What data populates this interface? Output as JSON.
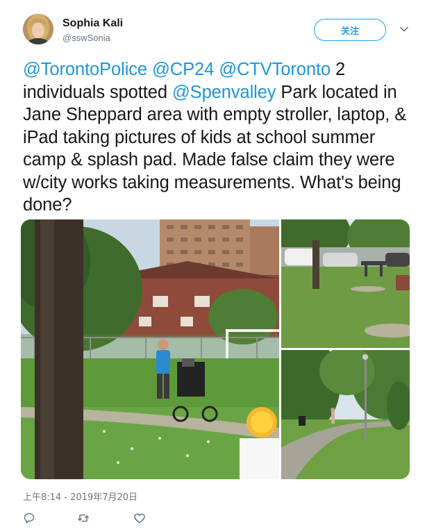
{
  "author": {
    "name": "Sophia Kali",
    "handle": "@sswSonia"
  },
  "follow_button": {
    "label": "关注"
  },
  "tweet": {
    "mentions": [
      "@TorontoPolice",
      "@CP24",
      "@CTVToronto",
      "@Spenvalley"
    ],
    "text_1": " 2 individuals spotted ",
    "text_2": " Park located in Jane Sheppard area with empty stroller, laptop, & iPad taking pictures of kids at school summer camp & splash pad. Made false claim they were w/city works taking measurements. What's being done?",
    "space": " "
  },
  "timestamp": "上午8:14 - 2019年7月20日",
  "media": {
    "photos": [
      {
        "icon": "park-stroller-photo"
      },
      {
        "icon": "park-cars-photo"
      },
      {
        "icon": "park-path-photo"
      }
    ]
  },
  "actions": [
    {
      "icon": "reply-icon"
    },
    {
      "icon": "retweet-icon"
    },
    {
      "icon": "like-icon"
    }
  ],
  "colors": {
    "link": "#1b95e0",
    "follow": "#1da1f2",
    "muted": "#657786",
    "text": "#14171a"
  }
}
